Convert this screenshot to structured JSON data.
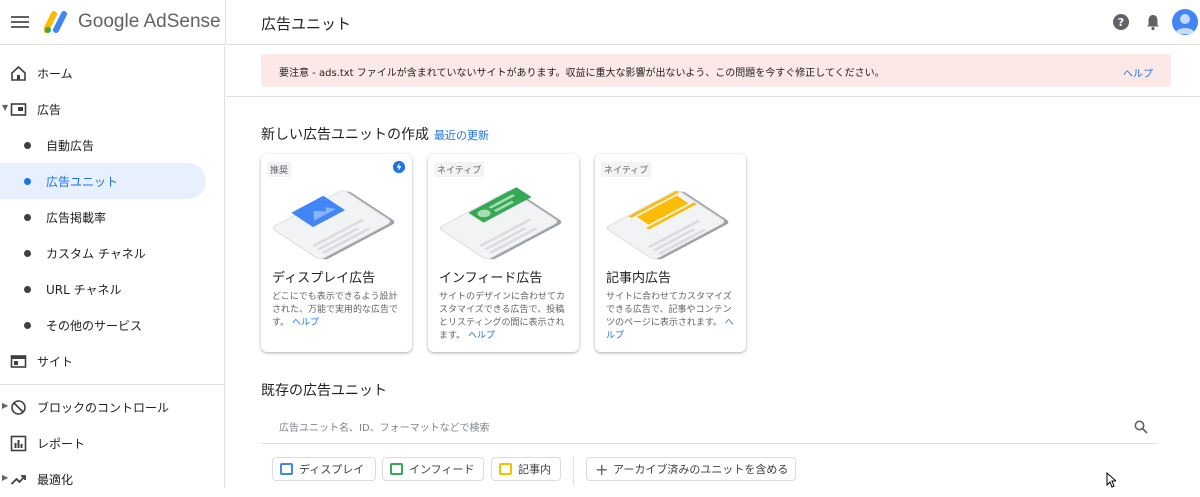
{
  "header": {
    "brand": "Google AdSense",
    "page_title": "広告ユニット"
  },
  "sidebar": {
    "items": [
      {
        "label": "ホーム"
      },
      {
        "label": "広告"
      },
      {
        "label": "自動広告"
      },
      {
        "label": "広告ユニット"
      },
      {
        "label": "広告掲載率"
      },
      {
        "label": "カスタム チャネル"
      },
      {
        "label": "URL チャネル"
      },
      {
        "label": "その他のサービス"
      },
      {
        "label": "サイト"
      },
      {
        "label": "ブロックのコントロール"
      },
      {
        "label": "レポート"
      },
      {
        "label": "最適化"
      }
    ]
  },
  "alert": {
    "text": "要注意 - ads.txt ファイルが含まれていないサイトがあります。収益に重大な影響が出ないよう、この問題を今すぐ修正してください。",
    "help": "ヘルプ"
  },
  "create": {
    "title": "新しい広告ユニットの作成",
    "recent_link": "最近の更新",
    "cards": [
      {
        "tag": "推奨",
        "title": "ディスプレイ広告",
        "desc": "どこにでも表示できるよう設計された、万能で実用的な広告です。",
        "help": "ヘルプ",
        "accent": "#4285f4"
      },
      {
        "tag": "ネイティブ",
        "title": "インフィード広告",
        "desc": "サイトのデザインに合わせてカスタマイズできる広告で、投稿とリスティングの間に表示されます。",
        "help": "ヘルプ",
        "accent": "#34a853"
      },
      {
        "tag": "ネイティブ",
        "title": "記事内広告",
        "desc": "サイトに合わせてカスタマイズできる広告で、記事やコンテンツのページに表示されます。",
        "help": "ヘルプ",
        "accent": "#fbbc04"
      }
    ]
  },
  "existing": {
    "title": "既存の広告ユニット",
    "search_placeholder": "広告ユニット名、ID、フォーマットなどで検索",
    "chips": [
      {
        "label": "ディスプレイ",
        "color": "#4285f4"
      },
      {
        "label": "インフィード",
        "color": "#34a853"
      },
      {
        "label": "記事内",
        "color": "#fbbc04"
      }
    ],
    "archive_chip": "アーカイブ済みのユニットを含める"
  }
}
